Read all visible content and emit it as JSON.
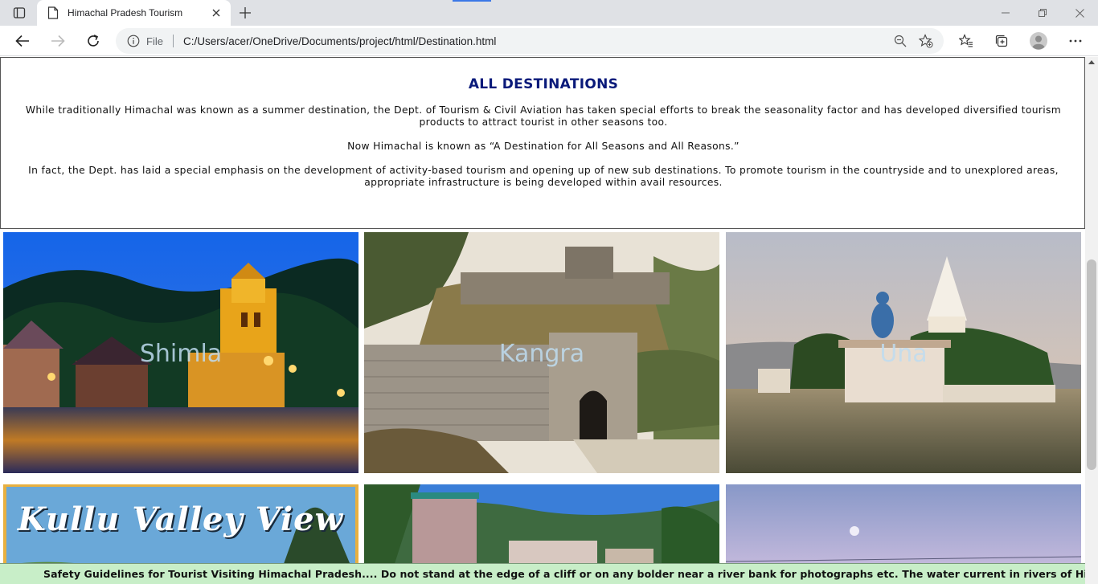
{
  "browser": {
    "tab_title": "Himachal Pradesh Tourism",
    "url_scheme": "File",
    "url": "C:/Users/acer/OneDrive/Documents/project/html/Destination.html"
  },
  "intro": {
    "title": "ALL DESTINATIONS",
    "paragraph1": "While traditionally Himachal was known as a summer destination, the Dept. of Tourism & Civil Aviation has taken special efforts to break the seasonality factor and has developed diversified tourism products to attract tourist in other seasons too.",
    "paragraph2": "Now Himachal is known as “A Destination for All Seasons and All Reasons.”",
    "paragraph3": "In fact, the Dept. has laid a special emphasis on the development of activity-based tourism and opening up of new sub destinations. To promote tourism in the countryside and to unexplored areas, appropriate infrastructure is being developed within avail resources."
  },
  "destinations": [
    {
      "label": "Shimla"
    },
    {
      "label": "Kangra"
    },
    {
      "label": "Una"
    },
    {
      "label": "",
      "banner_text": "Kullu Valley View"
    },
    {
      "label": ""
    },
    {
      "label": ""
    }
  ],
  "marquee": {
    "text": "Safety Guidelines for Tourist Visiting Himachal Pradesh.... Do not stand at the edge of a cliff or on any bolder near a river bank for photographs etc. The water current in rivers of Himachal Pradesh is very strong"
  },
  "icons": {
    "sidebar": "sidebar-toggle-icon",
    "page": "page-icon",
    "close": "close-icon",
    "add": "plus-icon",
    "back": "back-arrow-icon",
    "forward": "forward-arrow-icon",
    "refresh": "refresh-icon",
    "info": "info-icon",
    "zoom": "zoom-out-icon",
    "favorite": "star-add-icon",
    "favorites": "favorites-icon",
    "collections": "collections-icon",
    "profile": "profile-icon",
    "more": "more-icon"
  }
}
